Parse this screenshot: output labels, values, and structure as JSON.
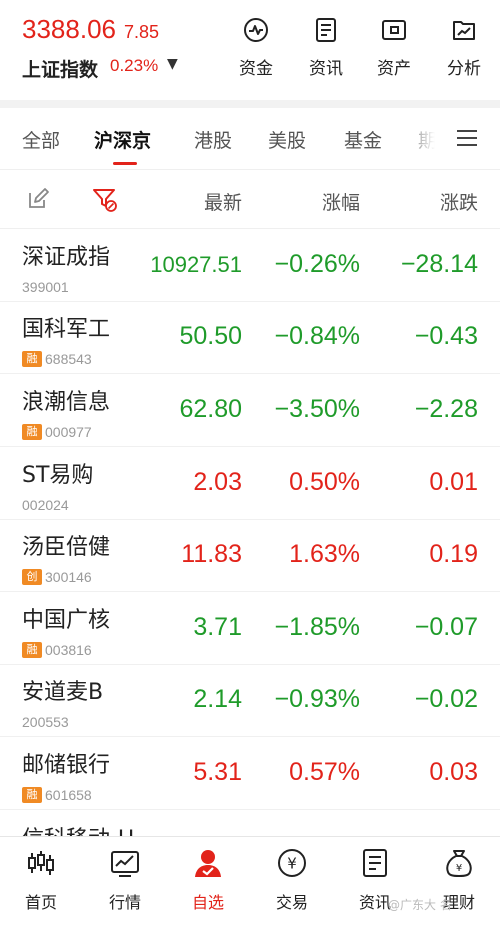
{
  "header": {
    "index_price": "3388.06",
    "index_change": "7.85",
    "index_name": "上证指数",
    "index_pct": "0.23%",
    "quick_actions": [
      {
        "label": "资金",
        "icon": "fund-flow-icon"
      },
      {
        "label": "资讯",
        "icon": "news-icon"
      },
      {
        "label": "资产",
        "icon": "wallet-icon"
      },
      {
        "label": "分析",
        "icon": "analysis-chart-icon"
      }
    ]
  },
  "tabs": [
    "全部",
    "沪深京",
    "港股",
    "美股",
    "基金",
    "期"
  ],
  "active_tab": "沪深京",
  "columns": {
    "latest": "最新",
    "pct": "涨幅",
    "change": "涨跌"
  },
  "rows": [
    {
      "name": "深证成指",
      "badge": "",
      "code": "399001",
      "price": "10927.51",
      "pct": "−0.26%",
      "change": "−28.14",
      "dir": "down"
    },
    {
      "name": "国科军工",
      "badge": "融",
      "code": "688543",
      "price": "50.50",
      "pct": "−0.84%",
      "change": "−0.43",
      "dir": "down"
    },
    {
      "name": "浪潮信息",
      "badge": "融",
      "code": "000977",
      "price": "62.80",
      "pct": "−3.50%",
      "change": "−2.28",
      "dir": "down"
    },
    {
      "name": "ST易购",
      "badge": "",
      "code": "002024",
      "price": "2.03",
      "pct": "0.50%",
      "change": "0.01",
      "dir": "up"
    },
    {
      "name": "汤臣倍健",
      "badge": "创",
      "code": "300146",
      "price": "11.83",
      "pct": "1.63%",
      "change": "0.19",
      "dir": "up"
    },
    {
      "name": "中国广核",
      "badge": "融",
      "code": "003816",
      "price": "3.71",
      "pct": "−1.85%",
      "change": "−0.07",
      "dir": "down"
    },
    {
      "name": "安道麦B",
      "badge": "",
      "code": "200553",
      "price": "2.14",
      "pct": "−0.93%",
      "change": "−0.02",
      "dir": "down"
    },
    {
      "name": "邮储银行",
      "badge": "融",
      "code": "601658",
      "price": "5.31",
      "pct": "0.57%",
      "change": "0.03",
      "dir": "up"
    }
  ],
  "partial_row_name": "信科移动-U",
  "bottom_nav": [
    {
      "label": "首页",
      "icon": "candlestick-icon"
    },
    {
      "label": "行情",
      "icon": "market-chart-icon"
    },
    {
      "label": "自选",
      "icon": "watchlist-person-icon"
    },
    {
      "label": "交易",
      "icon": "yuan-coin-icon"
    },
    {
      "label": "资讯",
      "icon": "news-doc-icon"
    },
    {
      "label": "理财",
      "icon": "money-bag-icon"
    }
  ],
  "active_nav": "自选",
  "watermark": "@广东大 名",
  "colors": {
    "up": "#e2231a",
    "down": "#1f9b2a",
    "accent": "#e2231a",
    "badge": "#f08a24"
  }
}
